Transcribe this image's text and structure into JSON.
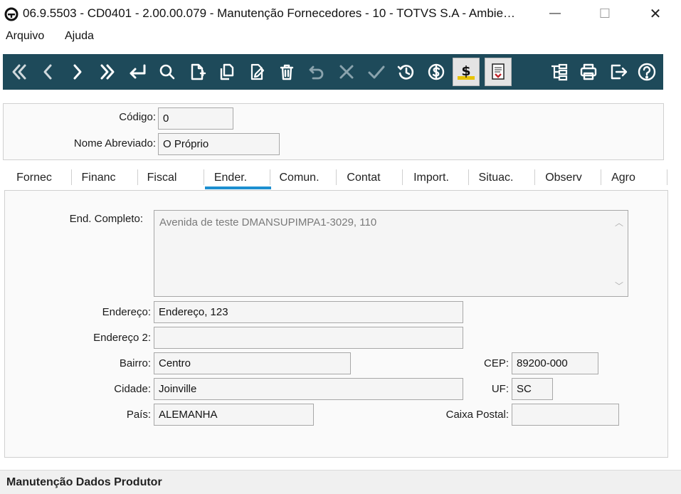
{
  "window": {
    "title": "06.9.5503 - CD0401 - 2.00.00.079 - Manutenção Fornecedores - 10 - TOTVS S.A - Ambie…",
    "minimize_glyph": "—",
    "maximize_glyph": "☐",
    "close_glyph": "✕"
  },
  "menu": {
    "items": [
      "Arquivo",
      "Ajuda"
    ]
  },
  "toolbar": {
    "background": "#1e4a5a",
    "icons": [
      "first-record-icon",
      "previous-record-icon",
      "next-record-icon",
      "last-record-icon",
      "go-to-icon",
      "search-icon",
      "new-record-icon",
      "copy-record-icon",
      "edit-record-icon",
      "delete-icon",
      "undo-icon",
      "cancel-icon",
      "confirm-icon",
      "history-icon",
      "currency-icon",
      "financial-icon",
      "report-icon",
      "tree-icon",
      "print-icon",
      "exit-icon",
      "help-icon"
    ]
  },
  "header": {
    "codigo_label": "Código:",
    "codigo_value": "0",
    "nome_label": "Nome Abreviado:",
    "nome_value": "O Próprio"
  },
  "tabs": {
    "items": [
      "Fornec",
      "Financ",
      "Fiscal",
      "Ender.",
      "Comun.",
      "Contat",
      "Import.",
      "Situac.",
      "Observ",
      "Agro"
    ],
    "active": "Ender.",
    "accent": "#1d8fd0"
  },
  "form": {
    "end_completo_label": "End. Completo:",
    "end_completo_value": "Avenida de teste DMANSUPIMPA1-3029, 110",
    "endereco_label": "Endereço:",
    "endereco_value": "Endereço, 123",
    "endereco2_label": "Endereço 2:",
    "endereco2_value": "",
    "bairro_label": "Bairro:",
    "bairro_value": "Centro",
    "cep_label": "CEP:",
    "cep_value": "89200-000",
    "cidade_label": "Cidade:",
    "cidade_value": "Joinville",
    "uf_label": "UF:",
    "uf_value": "SC",
    "pais_label": "País:",
    "pais_value": "ALEMANHA",
    "caixa_postal_label": "Caixa Postal:",
    "caixa_postal_value": ""
  },
  "status": {
    "text": "Manutenção Dados Produtor"
  }
}
